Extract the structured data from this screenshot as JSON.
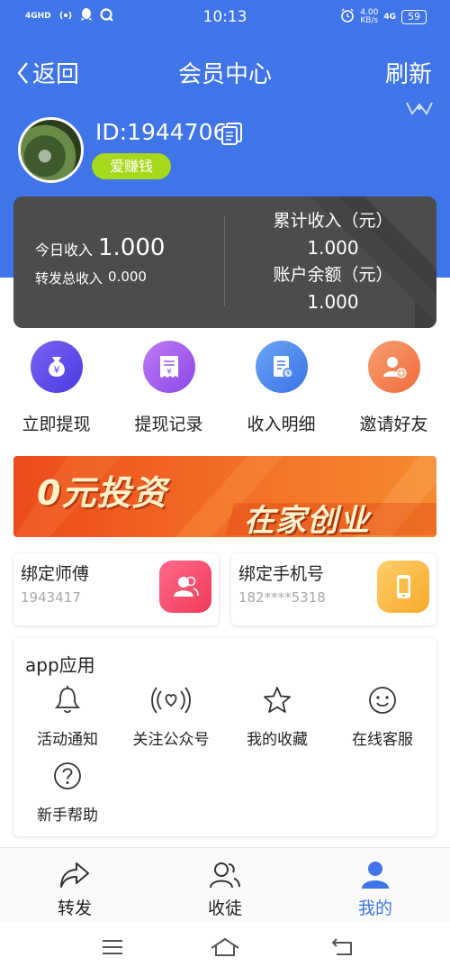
{
  "status_bar": {
    "signal": "4GHD",
    "time": "10:13",
    "net_speed": "4.00",
    "net_unit": "KB/s",
    "network": "4G",
    "battery": "59"
  },
  "nav": {
    "back_label": "返回",
    "title": "会员中心",
    "refresh_label": "刷新"
  },
  "profile": {
    "id_label": "ID:1944706",
    "badge": "爱赚钱"
  },
  "income": {
    "today_label": "今日收入",
    "today_value": "1.000",
    "share_label": "转发总收入",
    "share_value": "0.000",
    "total_label": "累计收入（元）",
    "total_value": "1.000",
    "balance_label": "账户余额（元）",
    "balance_value": "1.000"
  },
  "quick_actions": [
    {
      "label": "立即提现",
      "icon": "money-bag-icon",
      "color": "#6a4ff0"
    },
    {
      "label": "提现记录",
      "icon": "receipt-icon",
      "color": "#a463f0"
    },
    {
      "label": "收入明细",
      "icon": "document-clock-icon",
      "color": "#4f8ef0"
    },
    {
      "label": "邀请好友",
      "icon": "add-user-icon",
      "color": "#f47b4a"
    }
  ],
  "banner": {
    "text_1": "0元投资",
    "text_2": "在家创业"
  },
  "bind": {
    "master_title": "绑定师傅",
    "master_value": "1943417",
    "phone_title": "绑定手机号",
    "phone_value": "182****5318"
  },
  "apps": {
    "title": "app应用",
    "items": [
      {
        "label": "活动通知",
        "icon": "bell-icon"
      },
      {
        "label": "关注公众号",
        "icon": "broadcast-heart-icon"
      },
      {
        "label": "我的收藏",
        "icon": "star-icon"
      },
      {
        "label": "在线客服",
        "icon": "smile-icon"
      },
      {
        "label": "新手帮助",
        "icon": "help-icon"
      }
    ]
  },
  "tabbar": [
    {
      "label": "转发",
      "icon": "share-icon",
      "active": false
    },
    {
      "label": "收徒",
      "icon": "users-icon",
      "active": false
    },
    {
      "label": "我的",
      "icon": "user-icon",
      "active": true
    }
  ],
  "colors": {
    "primary": "#3f75e8",
    "card": "#4c4c4c",
    "badge": "#a6d81b",
    "banner": "#ec4a1b"
  }
}
